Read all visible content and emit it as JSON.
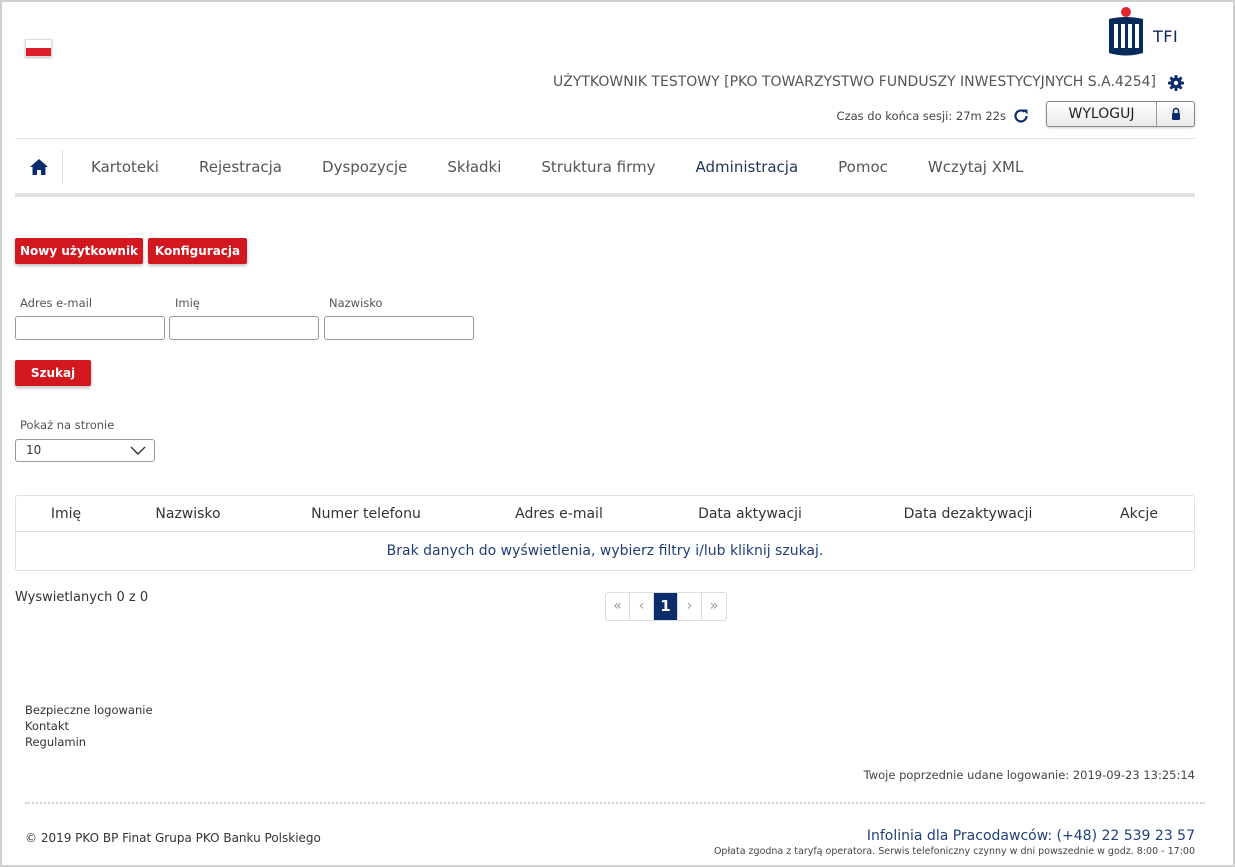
{
  "header": {
    "logo_text": "TFI",
    "user": "UŻYTKOWNIK TESTOWY [PKO TOWARZYSTWO FUNDUSZY INWESTYCYJNYCH S.A.4254]",
    "session": "Czas do końca sesji: 27m 22s",
    "logout_label": "WYLOGUJ"
  },
  "nav": {
    "items": [
      "Kartoteki",
      "Rejestracja",
      "Dyspozycje",
      "Składki",
      "Struktura firmy",
      "Administracja",
      "Pomoc",
      "Wczytaj XML"
    ],
    "active": "Administracja"
  },
  "actions": {
    "new_user": "Nowy użytkownik",
    "config": "Konfiguracja"
  },
  "filters": {
    "email_label": "Adres e-mail",
    "first_name_label": "Imię",
    "last_name_label": "Nazwisko",
    "search_button": "Szukaj"
  },
  "page_size": {
    "label": "Pokaż na stronie",
    "value": "10"
  },
  "table": {
    "columns": [
      "Imię",
      "Nazwisko",
      "Numer telefonu",
      "Adres e-mail",
      "Data aktywacji",
      "Data dezaktywacji",
      "Akcje"
    ],
    "empty_message": "Brak danych do wyświetlenia, wybierz filtry i/lub kliknij szukaj."
  },
  "pagination": {
    "count_text": "Wyswietlanych 0 z 0",
    "first": "«",
    "prev": "‹",
    "current": "1",
    "next": "›",
    "last": "»"
  },
  "footer": {
    "links": [
      "Bezpieczne logowanie",
      "Kontakt",
      "Regulamin"
    ],
    "last_login": "Twoje poprzednie udane logowanie: 2019-09-23 13:25:14",
    "copyright": "© 2019 PKO BP Finat Grupa PKO Banku Polskiego",
    "hotline": "Infolinia dla Pracodawców: (+48) 22 539 23 57",
    "hotline_note": "Opłata zgodna z taryfą operatora. Serwis telefoniczny czynny w dni powszednie w godz. 8:00 - 17:00"
  },
  "colors": {
    "accent_red": "#d3171f",
    "navy": "#0b2d6c"
  }
}
